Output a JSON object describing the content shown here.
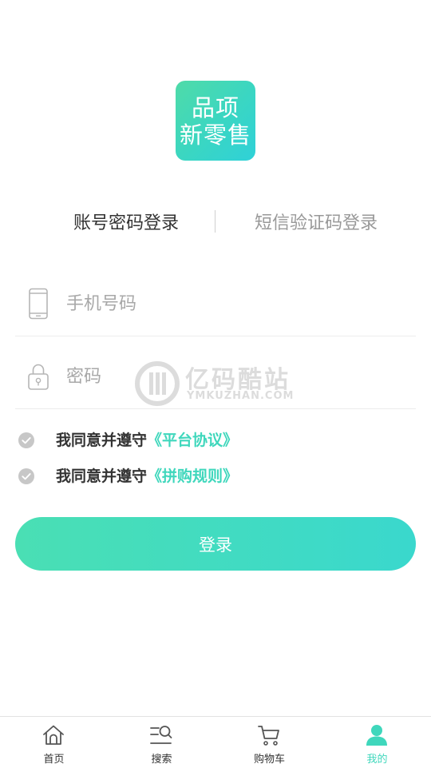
{
  "brand": {
    "logo_line1": "品项",
    "logo_line2": "新零售",
    "accent_color": "#3fd7bc"
  },
  "tabs": [
    {
      "label": "账号密码登录",
      "active": true
    },
    {
      "label": "短信验证码登录",
      "active": false
    }
  ],
  "form": {
    "phone": {
      "placeholder": "手机号码",
      "value": "",
      "icon": "phone-icon"
    },
    "password": {
      "placeholder": "密码",
      "value": "",
      "icon": "lock-icon"
    }
  },
  "agreements": [
    {
      "text": "我同意并遵守",
      "link": "《平台协议》",
      "checked": false
    },
    {
      "text": "我同意并遵守",
      "link": "《拼购规则》",
      "checked": false
    }
  ],
  "login_button": {
    "label": "登录"
  },
  "watermark": {
    "title": "亿码酷站",
    "subtitle": "YMKUZHAN.COM"
  },
  "bottom_nav": [
    {
      "label": "首页",
      "icon": "home-icon",
      "active": false
    },
    {
      "label": "搜索",
      "icon": "search-icon",
      "active": false
    },
    {
      "label": "购物车",
      "icon": "cart-icon",
      "active": false
    },
    {
      "label": "我的",
      "icon": "user-icon",
      "active": true
    }
  ]
}
